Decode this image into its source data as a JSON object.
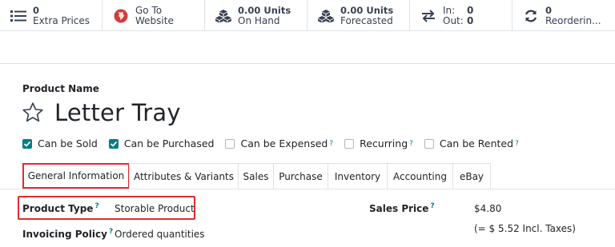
{
  "smart_buttons": {
    "extra_prices": {
      "value": "0",
      "label": "Extra Prices"
    },
    "website": {
      "line1": "Go To",
      "line2": "Website"
    },
    "on_hand": {
      "value": "0.00 Units",
      "label": "On Hand"
    },
    "forecasted": {
      "value": "0.00 Units",
      "label": "Forecasted"
    },
    "in_out": {
      "in_label": "In:",
      "in_value": "0",
      "out_label": "Out:",
      "out_value": "0"
    },
    "reordering": {
      "value": "0",
      "label": "Reorderin..."
    }
  },
  "form": {
    "product_name_label": "Product Name",
    "product_name": "Letter Tray",
    "checkboxes": [
      {
        "label": "Can be Sold",
        "checked": true,
        "tooltip": ""
      },
      {
        "label": "Can be Purchased",
        "checked": true,
        "tooltip": ""
      },
      {
        "label": "Can be Expensed",
        "checked": false,
        "tooltip": "?"
      },
      {
        "label": "Recurring",
        "checked": false,
        "tooltip": "?"
      },
      {
        "label": "Can be Rented",
        "checked": false,
        "tooltip": "?"
      }
    ],
    "tabs": [
      "General Information",
      "Attributes & Variants",
      "Sales",
      "Purchase",
      "Inventory",
      "Accounting",
      "eBay"
    ],
    "active_tab": "General Information",
    "fields": {
      "product_type_label": "Product Type",
      "product_type_tip": "?",
      "product_type_value": "Storable Product",
      "invoicing_policy_label": "Invoicing Policy",
      "invoicing_policy_tip": "?",
      "invoicing_policy_value": "Ordered quantities",
      "sales_price_label": "Sales Price",
      "sales_price_tip": "?",
      "sales_price_value": "$4.80",
      "sales_price_incl": "(= $ 5.52 Incl. Taxes)"
    }
  },
  "colors": {
    "accent": "#017e84",
    "highlight": "#e02d2d",
    "globe": "#d63a3a"
  }
}
